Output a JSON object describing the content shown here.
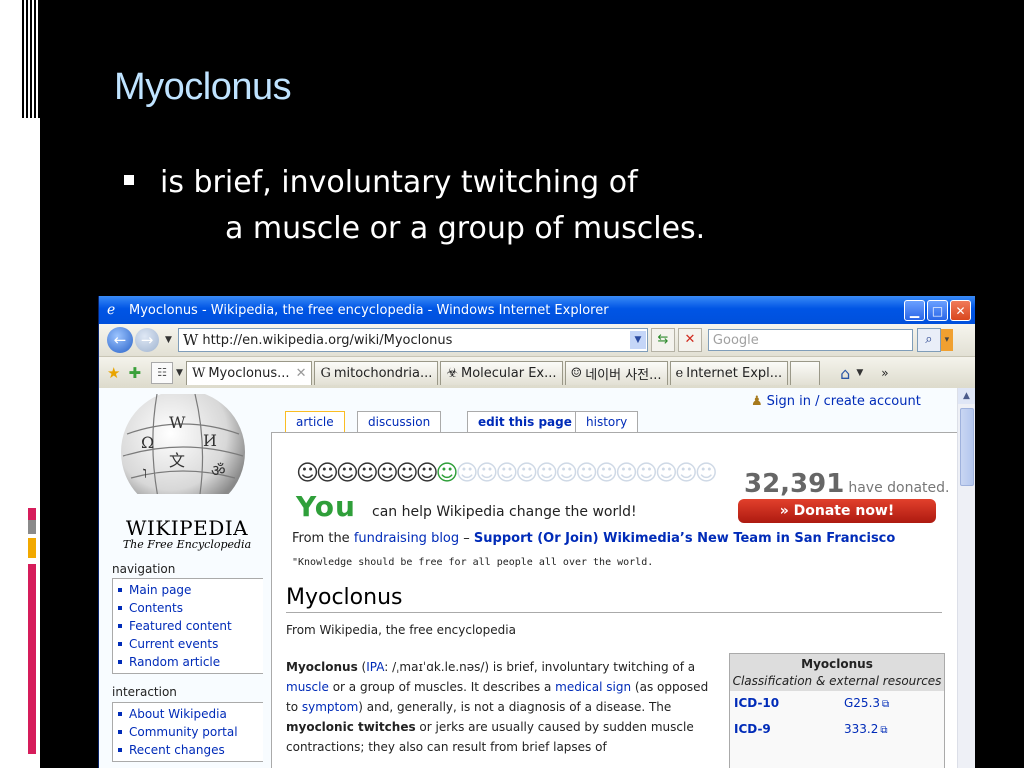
{
  "slide": {
    "title": "Myoclonus",
    "bullet_line1": "is brief, involuntary twitching of",
    "bullet_line2": "a muscle or a group of muscles."
  },
  "browser": {
    "window_title": "Myoclonus - Wikipedia, the free encyclopedia - Windows Internet Explorer",
    "address": "http://en.wikipedia.org/wiki/Myoclonus",
    "search_placeholder": "Google",
    "tabs": [
      {
        "label": "Myoclonus...",
        "icon": "W",
        "active": true
      },
      {
        "label": "mitochondria...",
        "icon": "G"
      },
      {
        "label": "Molecular Ex...",
        "icon": "☣"
      },
      {
        "label": "네이버 사전...",
        "icon": "☺"
      },
      {
        "label": "Internet Expl...",
        "icon": "e"
      }
    ]
  },
  "wiki": {
    "wordmark": "Wikipedia",
    "tagline": "The Free Encyclopedia",
    "signin": "Sign in / create account",
    "content_tabs": [
      "article",
      "discussion",
      "edit this page",
      "history"
    ],
    "navigation_title": "navigation",
    "navigation": [
      "Main page",
      "Contents",
      "Featured content",
      "Current events",
      "Random article"
    ],
    "interaction_title": "interaction",
    "interaction": [
      "About Wikipedia",
      "Community portal",
      "Recent changes"
    ],
    "banner": {
      "you": "You",
      "can_help": "can help Wikipedia change the world!",
      "donated_count": "32,391",
      "donated_text": "have donated.",
      "donate_button": "» Donate now!",
      "from_the": "From the",
      "blog_link": "fundraising blog",
      "dash": "–",
      "support_link": "Support (Or Join) Wikimedia’s New Team in San Francisco",
      "quote": "\"Knowledge should be free for all people all over the world."
    },
    "heading": "Myoclonus",
    "site_sub": "From Wikipedia, the free encyclopedia",
    "body": {
      "term": "Myoclonus",
      "ipa_open": " (",
      "ipa_link": "IPA",
      "ipa_rest": ": /ˌmaɪˈɑk.le.nəs/) is brief, involuntary twitching of a",
      "muscle": "muscle",
      "t1": " or a group of muscles. It describes a ",
      "medical_sign": "medical sign",
      "t2": " (as opposed to ",
      "symptom": "symptom",
      "t3": ") and, generally, is not a diagnosis of a disease. The ",
      "bold2": "myoclonic twitches",
      "t4": " or jerks are usually caused by sudden muscle contractions; they also can result from brief lapses of"
    },
    "infobox": {
      "title": "Myoclonus",
      "subtitle": "Classification & external resources",
      "rows": [
        {
          "key": "ICD-10",
          "value": "G25.3"
        },
        {
          "key": "ICD-9",
          "value": "333.2"
        }
      ]
    }
  }
}
